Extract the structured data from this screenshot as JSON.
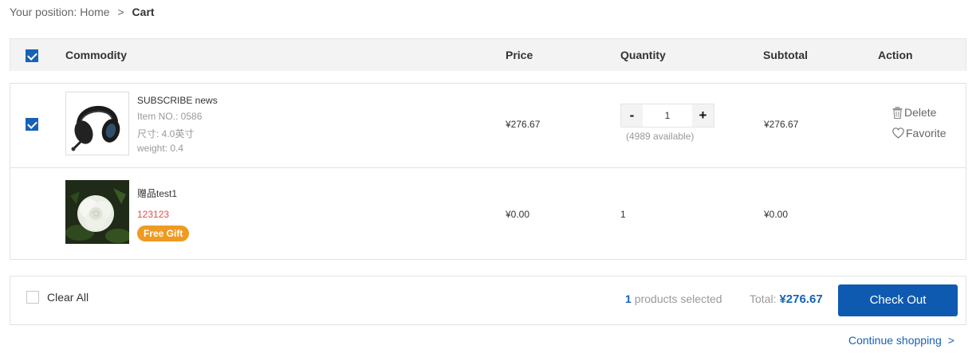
{
  "breadcrumb": {
    "prefix": "Your position:",
    "home": "Home",
    "separator": ">",
    "current": "Cart"
  },
  "table_header": {
    "select_all_checked": true,
    "commodity": "Commodity",
    "price": "Price",
    "quantity": "Quantity",
    "subtotal": "Subtotal",
    "action": "Action"
  },
  "items": [
    {
      "checked": true,
      "name": "SUBSCRIBE news",
      "item_no": "Item NO.: 0586",
      "size": "尺寸: 4.0英寸",
      "weight": "weight: 0.4",
      "image": "headset-image",
      "price": "¥276.67",
      "quantity": "1",
      "qty_minus": "-",
      "qty_plus": "+",
      "available": "(4989 available)",
      "subtotal": "¥276.67",
      "delete_label": "Delete",
      "favorite_label": "Favorite"
    },
    {
      "name": "赠品test1",
      "code": "123123",
      "badge": "Free Gift",
      "image": "white-rose-image",
      "price": "¥0.00",
      "quantity": "1",
      "subtotal": "¥0.00"
    }
  ],
  "footer": {
    "clear_all_checked": false,
    "clear_all": "Clear All",
    "selected_count": "1",
    "selected_label": "products selected",
    "total_label": "Total:",
    "total_amount": "¥276.67",
    "checkout": "Check Out"
  },
  "continue_shopping": "Continue shopping",
  "continue_arrow": ">",
  "colors": {
    "accent": "#1762b5",
    "checkout_button": "#0f5ab1",
    "gift_badge": "#ef9b22",
    "gift_code": "#e0504a"
  }
}
